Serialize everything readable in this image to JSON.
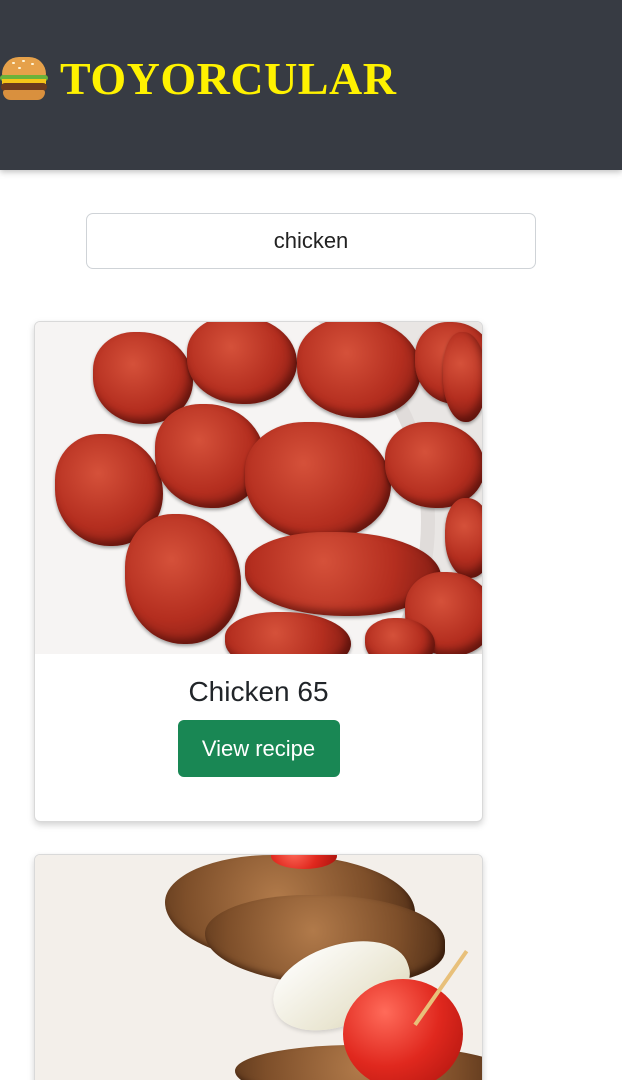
{
  "header": {
    "brand_emoji": "hamburger-icon",
    "brand_name": "TOYORCULAR",
    "colors": {
      "background": "#373b43",
      "brand_text": "#fff200"
    }
  },
  "search": {
    "value": "chicken",
    "placeholder": ""
  },
  "recipes": [
    {
      "title": "Chicken 65",
      "button_label": "View recipe"
    },
    {
      "title": "",
      "button_label": ""
    }
  ],
  "colors": {
    "button": "#198754"
  }
}
